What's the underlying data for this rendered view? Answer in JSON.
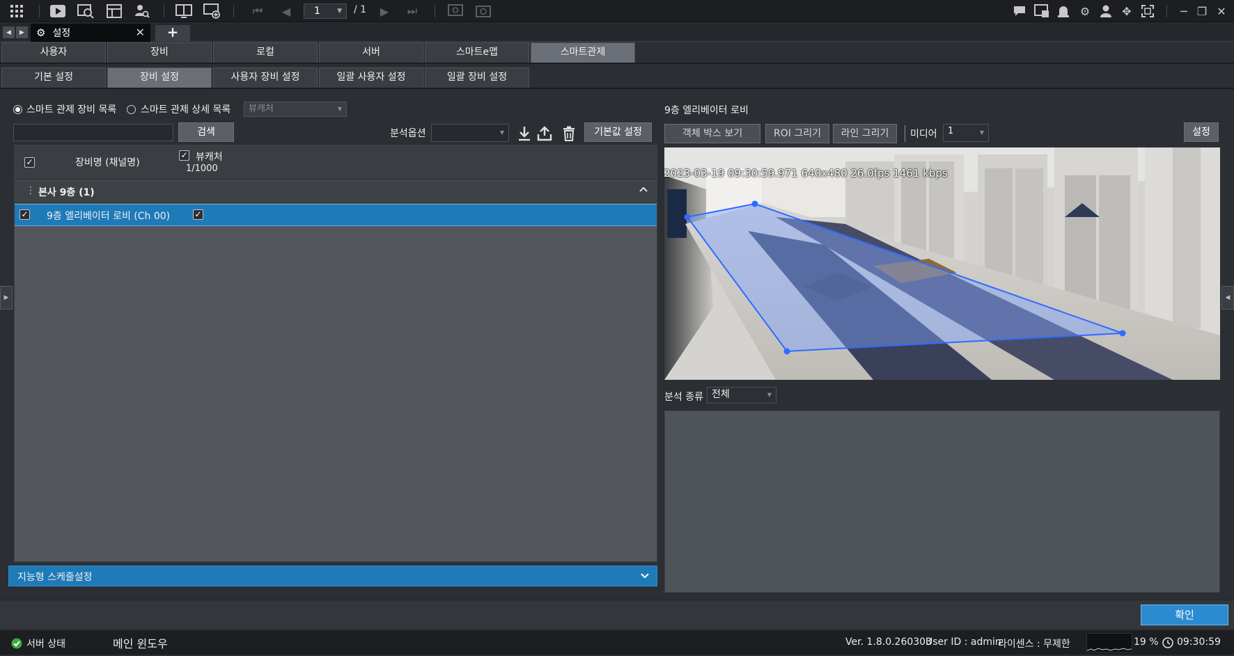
{
  "toolbar": {
    "page_current": "1",
    "page_total": "/ 1"
  },
  "doc_tab": {
    "title": "설정"
  },
  "main_tabs": [
    "사용자",
    "장비",
    "로컬",
    "서버",
    "스마트e맵",
    "스마트관제"
  ],
  "sub_tabs": [
    "기본 설정",
    "장비 설정",
    "사용자 장비 설정",
    "일괄 사용자 설정",
    "일괄 장비 설정"
  ],
  "left": {
    "radio_list": "스마트 관제 장비 목록",
    "radio_detail": "스마트 관제 상세 목록",
    "type_combo": "뷰캐처",
    "search_value": "",
    "search_button": "검색",
    "analysis_option_label": "분석옵션",
    "analysis_option_value": "",
    "default_button": "기본값 설정",
    "grid": {
      "col_device": "장비명 (채널명)",
      "col_capture": "뷰캐처",
      "col_capture_count": "1/1000",
      "group": "본사 9층 (1)",
      "rows": [
        {
          "name": "9층 엘리베이터 로비 (Ch 00)"
        }
      ]
    },
    "schedule_bar": "지능형 스케줄설정"
  },
  "right": {
    "camera_title": "9층 엘리베이터 로비",
    "btn_object_box": "객체 박스 보기",
    "btn_roi": "ROI 그리기",
    "btn_line": "라인 그리기",
    "media_label": "미디어",
    "media_value": "1",
    "settings_button": "설정",
    "osd": "2023-03-19 09:30:59.971 640x480  26.0fps 1461 kbps",
    "analysis_type_label": "분석 종류",
    "analysis_type_value": "전체"
  },
  "footer": {
    "ok_button": "확인"
  },
  "status": {
    "server_state": "서버 상태",
    "window": "메인 윈도우",
    "version": "Ver. 1.8.0.260303",
    "user": "User ID : admin",
    "license": "라이센스 : 무제한",
    "cpu": "19 %",
    "clock": "09:30:59"
  },
  "colors": {
    "accent": "#1f7ab8",
    "roi_fill": "#7fa3ff",
    "roi_stroke": "#2f6bff"
  }
}
